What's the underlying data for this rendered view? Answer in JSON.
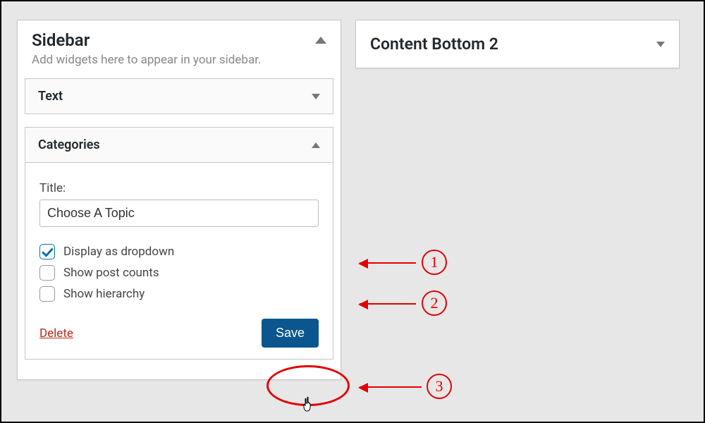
{
  "sidebar_area": {
    "title": "Sidebar",
    "description": "Add widgets here to appear in your sidebar."
  },
  "widgets": {
    "text": {
      "name": "Text"
    },
    "categories": {
      "name": "Categories",
      "title_label": "Title:",
      "title_value": "Choose A Topic",
      "opt_dropdown": "Display as dropdown",
      "opt_counts": "Show post counts",
      "opt_hierarchy": "Show hierarchy",
      "delete": "Delete",
      "save": "Save"
    }
  },
  "content_bottom": {
    "title": "Content Bottom 2"
  },
  "annotations": {
    "n1": "1",
    "n2": "2",
    "n3": "3"
  }
}
